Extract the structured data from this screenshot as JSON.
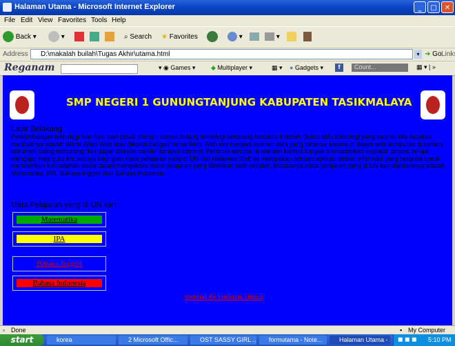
{
  "window": {
    "title": "Halaman Utama - Microsoft Internet Explorer",
    "min_glyph": "_",
    "max_glyph": "□",
    "close_glyph": "✕"
  },
  "menu": [
    "File",
    "Edit",
    "View",
    "Favorites",
    "Tools",
    "Help"
  ],
  "toolbar": {
    "back_label": "Back",
    "search_label": "Search",
    "favorites_label": "Favorites"
  },
  "address": {
    "label": "Address",
    "value": "D:\\makalah builah\\Tugas Akhir\\utama.html",
    "go_label": "Go",
    "links_label": "Links"
  },
  "linkbar": {
    "brand": "Reganam",
    "games_label": "Games",
    "multiplayer_label": "Multiplayer",
    "gadgets_label": "Gadgets",
    "count_label": "Count..."
  },
  "page": {
    "headline": "SMP NEGERI 1 GUNUNGTANJUNG KABUPATEN TASIKMALAYA",
    "background_color": "#0000ff",
    "headline_color": "#ffff00",
    "latar_title": "Latar Belakang",
    "latar_body": "Perkembangan teknologi kian hari kian pesat. Hampir semua bidang teknologi sekarang berbasis internet. Salah satu teknologi yang saat ini kita rasakan manfaatnya adalah World Wide Web atau dikenal dengan nama Web. Web kini menjadi sumber data yang terbesar karena di dalam web kumpulan dokumen-dokumen saling terhubung dan dapat diakses melalui koneksi internet. Pertama website di sekolah karena banyak memudahkan kegiatan proses belajar mengajar bagi guru khususnya bagi guru mata pelajaran yang di UN kan Halaman Web ini merupakan sebuah aplikasi sistem informasi yang berguna untuk memberikan kemudahan siswa dalam mengakses mata pelajaran yang diberikan oleh sekolah, khususnya mata pelajaran yang di UN kan diantaranya adalah Matematika, IPA, Bahasa Inggris dan Bahasa Indonesia.",
    "subjects_title": "Mata Pelajaran yang di UN kan :",
    "subjects": [
      {
        "label": "Matematika",
        "color": "#00aa00",
        "text_color": "#000000"
      },
      {
        "label": "IPA",
        "color": "#ffff00",
        "text_color": "#000000"
      },
      {
        "label": "Bahasa Inggris",
        "color": "#0000ff",
        "text_color": "#cc0000"
      },
      {
        "label": "Bahasa Indonesia",
        "color": "#ff0000",
        "text_color": "#000000"
      }
    ],
    "home_link": "Kembali Ke Halaman Utama"
  },
  "status": {
    "left": "Done",
    "zone": "My Computer"
  },
  "taskbar": {
    "start": "start",
    "tasks": [
      "korea",
      "2 Microsoft Offic...",
      "OST SASSY GIRL ...",
      "formutama - Note...",
      "Halaman Utama - ..."
    ],
    "clock": "5:10 PM"
  }
}
